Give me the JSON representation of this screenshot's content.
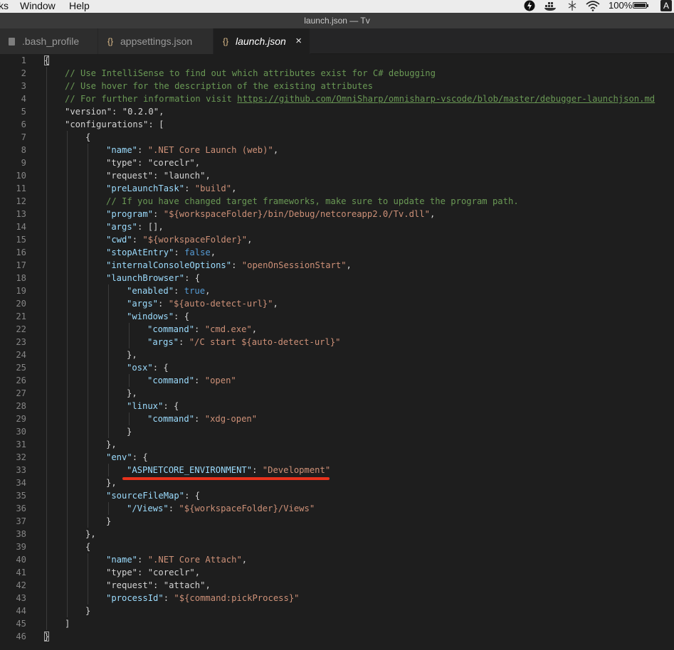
{
  "menubar": {
    "items": [
      "ks",
      "Window",
      "Help"
    ],
    "battery_text": "100%",
    "input_badge": "A"
  },
  "window": {
    "title": "launch.json — Tv"
  },
  "tabs": [
    {
      "label": ".bash_profile",
      "icon": "file-icon",
      "active": false
    },
    {
      "label": "appsettings.json",
      "icon": "{}",
      "active": false
    },
    {
      "label": "launch.json",
      "icon": "{}",
      "active": true,
      "close": "×"
    }
  ],
  "annotation": {
    "color": "#e8321c",
    "underlines_line": 33
  },
  "code": {
    "lines": [
      {
        "n": "1",
        "ind": 0,
        "t": [
          [
            "p",
            "{"
          ]
        ]
      },
      {
        "n": "2",
        "ind": 1,
        "t": [
          [
            "c",
            "// Use IntelliSense to find out which attributes exist for C# debugging"
          ]
        ]
      },
      {
        "n": "3",
        "ind": 1,
        "t": [
          [
            "c",
            "// Use hover for the description of the existing attributes"
          ]
        ]
      },
      {
        "n": "4",
        "ind": 1,
        "t": [
          [
            "c",
            "// For further information visit "
          ],
          [
            "u",
            "https://github.com/OmniSharp/omnisharp-vscode/blob/master/debugger-launchjson.md"
          ]
        ]
      },
      {
        "n": "5",
        "ind": 1,
        "t": [
          [
            "w",
            "\"version\""
          ],
          [
            "p",
            ": "
          ],
          [
            "w",
            "\"0.2.0\""
          ],
          [
            "p",
            ","
          ]
        ]
      },
      {
        "n": "6",
        "ind": 1,
        "t": [
          [
            "w",
            "\"configurations\""
          ],
          [
            "p",
            ": ["
          ]
        ]
      },
      {
        "n": "7",
        "ind": 2,
        "t": [
          [
            "p",
            "{"
          ]
        ]
      },
      {
        "n": "8",
        "ind": 3,
        "t": [
          [
            "k",
            "\"name\""
          ],
          [
            "p",
            ": "
          ],
          [
            "s",
            "\".NET Core Launch (web)\""
          ],
          [
            "p",
            ","
          ]
        ]
      },
      {
        "n": "9",
        "ind": 3,
        "t": [
          [
            "w",
            "\"type\""
          ],
          [
            "p",
            ": "
          ],
          [
            "w",
            "\"coreclr\""
          ],
          [
            "p",
            ","
          ]
        ]
      },
      {
        "n": "10",
        "ind": 3,
        "t": [
          [
            "w",
            "\"request\""
          ],
          [
            "p",
            ": "
          ],
          [
            "w",
            "\"launch\""
          ],
          [
            "p",
            ","
          ]
        ]
      },
      {
        "n": "11",
        "ind": 3,
        "t": [
          [
            "k",
            "\"preLaunchTask\""
          ],
          [
            "p",
            ": "
          ],
          [
            "s",
            "\"build\""
          ],
          [
            "p",
            ","
          ]
        ]
      },
      {
        "n": "12",
        "ind": 3,
        "t": [
          [
            "c",
            "// If you have changed target frameworks, make sure to update the program path."
          ]
        ]
      },
      {
        "n": "13",
        "ind": 3,
        "t": [
          [
            "k",
            "\"program\""
          ],
          [
            "p",
            ": "
          ],
          [
            "s",
            "\"${workspaceFolder}/bin/Debug/netcoreapp2.0/Tv.dll\""
          ],
          [
            "p",
            ","
          ]
        ]
      },
      {
        "n": "14",
        "ind": 3,
        "t": [
          [
            "k",
            "\"args\""
          ],
          [
            "p",
            ": [],"
          ]
        ]
      },
      {
        "n": "15",
        "ind": 3,
        "t": [
          [
            "k",
            "\"cwd\""
          ],
          [
            "p",
            ": "
          ],
          [
            "s",
            "\"${workspaceFolder}\""
          ],
          [
            "p",
            ","
          ]
        ]
      },
      {
        "n": "16",
        "ind": 3,
        "t": [
          [
            "k",
            "\"stopAtEntry\""
          ],
          [
            "p",
            ": "
          ],
          [
            "b",
            "false"
          ],
          [
            "p",
            ","
          ]
        ]
      },
      {
        "n": "17",
        "ind": 3,
        "t": [
          [
            "k",
            "\"internalConsoleOptions\""
          ],
          [
            "p",
            ": "
          ],
          [
            "s",
            "\"openOnSessionStart\""
          ],
          [
            "p",
            ","
          ]
        ]
      },
      {
        "n": "18",
        "ind": 3,
        "t": [
          [
            "k",
            "\"launchBrowser\""
          ],
          [
            "p",
            ": {"
          ]
        ]
      },
      {
        "n": "19",
        "ind": 4,
        "t": [
          [
            "k",
            "\"enabled\""
          ],
          [
            "p",
            ": "
          ],
          [
            "b",
            "true"
          ],
          [
            "p",
            ","
          ]
        ]
      },
      {
        "n": "20",
        "ind": 4,
        "t": [
          [
            "k",
            "\"args\""
          ],
          [
            "p",
            ": "
          ],
          [
            "s",
            "\"${auto-detect-url}\""
          ],
          [
            "p",
            ","
          ]
        ]
      },
      {
        "n": "21",
        "ind": 4,
        "t": [
          [
            "k",
            "\"windows\""
          ],
          [
            "p",
            ": {"
          ]
        ]
      },
      {
        "n": "22",
        "ind": 5,
        "t": [
          [
            "k",
            "\"command\""
          ],
          [
            "p",
            ": "
          ],
          [
            "s",
            "\"cmd.exe\""
          ],
          [
            "p",
            ","
          ]
        ]
      },
      {
        "n": "23",
        "ind": 5,
        "t": [
          [
            "k",
            "\"args\""
          ],
          [
            "p",
            ": "
          ],
          [
            "s",
            "\"/C start ${auto-detect-url}\""
          ]
        ]
      },
      {
        "n": "24",
        "ind": 4,
        "t": [
          [
            "p",
            "},"
          ]
        ]
      },
      {
        "n": "25",
        "ind": 4,
        "t": [
          [
            "k",
            "\"osx\""
          ],
          [
            "p",
            ": {"
          ]
        ]
      },
      {
        "n": "26",
        "ind": 5,
        "t": [
          [
            "k",
            "\"command\""
          ],
          [
            "p",
            ": "
          ],
          [
            "s",
            "\"open\""
          ]
        ]
      },
      {
        "n": "27",
        "ind": 4,
        "t": [
          [
            "p",
            "},"
          ]
        ]
      },
      {
        "n": "28",
        "ind": 4,
        "t": [
          [
            "k",
            "\"linux\""
          ],
          [
            "p",
            ": {"
          ]
        ]
      },
      {
        "n": "29",
        "ind": 5,
        "t": [
          [
            "k",
            "\"command\""
          ],
          [
            "p",
            ": "
          ],
          [
            "s",
            "\"xdg-open\""
          ]
        ]
      },
      {
        "n": "30",
        "ind": 4,
        "t": [
          [
            "p",
            "}"
          ]
        ]
      },
      {
        "n": "31",
        "ind": 3,
        "t": [
          [
            "p",
            "},"
          ]
        ]
      },
      {
        "n": "32",
        "ind": 3,
        "t": [
          [
            "k",
            "\"env\""
          ],
          [
            "p",
            ": {"
          ]
        ]
      },
      {
        "n": "33",
        "ind": 4,
        "t": [
          [
            "k",
            "\"ASPNETCORE_ENVIRONMENT\""
          ],
          [
            "p",
            ": "
          ],
          [
            "s",
            "\"Development\""
          ]
        ]
      },
      {
        "n": "34",
        "ind": 3,
        "t": [
          [
            "p",
            "},"
          ]
        ]
      },
      {
        "n": "35",
        "ind": 3,
        "t": [
          [
            "k",
            "\"sourceFileMap\""
          ],
          [
            "p",
            ": {"
          ]
        ]
      },
      {
        "n": "36",
        "ind": 4,
        "t": [
          [
            "k",
            "\"/Views\""
          ],
          [
            "p",
            ": "
          ],
          [
            "s",
            "\"${workspaceFolder}/Views\""
          ]
        ]
      },
      {
        "n": "37",
        "ind": 3,
        "t": [
          [
            "p",
            "}"
          ]
        ]
      },
      {
        "n": "38",
        "ind": 2,
        "t": [
          [
            "p",
            "},"
          ]
        ]
      },
      {
        "n": "39",
        "ind": 2,
        "t": [
          [
            "p",
            "{"
          ]
        ]
      },
      {
        "n": "40",
        "ind": 3,
        "t": [
          [
            "k",
            "\"name\""
          ],
          [
            "p",
            ": "
          ],
          [
            "s",
            "\".NET Core Attach\""
          ],
          [
            "p",
            ","
          ]
        ]
      },
      {
        "n": "41",
        "ind": 3,
        "t": [
          [
            "w",
            "\"type\""
          ],
          [
            "p",
            ": "
          ],
          [
            "w",
            "\"coreclr\""
          ],
          [
            "p",
            ","
          ]
        ]
      },
      {
        "n": "42",
        "ind": 3,
        "t": [
          [
            "w",
            "\"request\""
          ],
          [
            "p",
            ": "
          ],
          [
            "w",
            "\"attach\""
          ],
          [
            "p",
            ","
          ]
        ]
      },
      {
        "n": "43",
        "ind": 3,
        "t": [
          [
            "k",
            "\"processId\""
          ],
          [
            "p",
            ": "
          ],
          [
            "s",
            "\"${command:pickProcess}\""
          ]
        ]
      },
      {
        "n": "44",
        "ind": 2,
        "t": [
          [
            "p",
            "}"
          ]
        ]
      },
      {
        "n": "45",
        "ind": 1,
        "t": [
          [
            "p",
            "]"
          ]
        ]
      },
      {
        "n": "46",
        "ind": 0,
        "t": [
          [
            "p",
            "}"
          ]
        ]
      }
    ]
  }
}
